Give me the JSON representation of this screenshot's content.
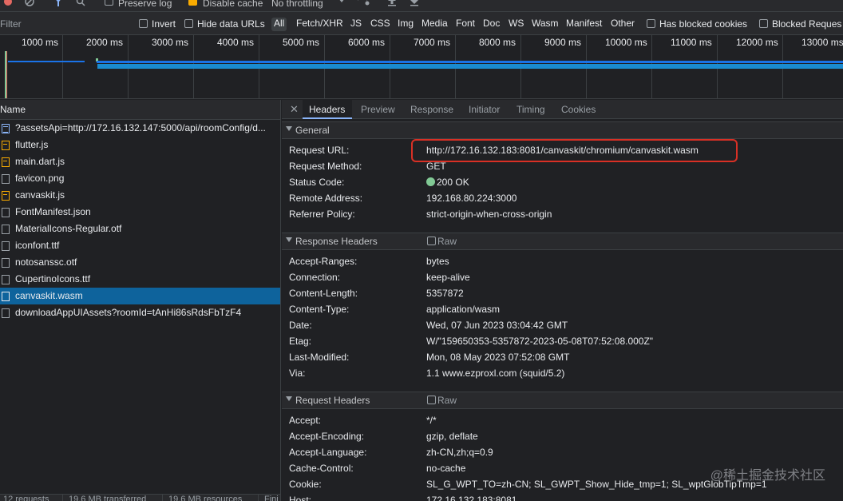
{
  "toolbar": {
    "preserve_log_label": "Preserve log",
    "disable_cache_label": "Disable cache",
    "throttling_value": "No throttling"
  },
  "filter": {
    "placeholder": "Filter",
    "invert_label": "Invert",
    "hide_data_urls_label": "Hide data URLs",
    "types": [
      "All",
      "Fetch/XHR",
      "JS",
      "CSS",
      "Img",
      "Media",
      "Font",
      "Doc",
      "WS",
      "Wasm",
      "Manifest",
      "Other"
    ],
    "has_blocked_cookies_label": "Has blocked cookies",
    "blocked_requests_label": "Blocked Reques"
  },
  "timeline": {
    "ticks": [
      "1000 ms",
      "2000 ms",
      "3000 ms",
      "4000 ms",
      "5000 ms",
      "6000 ms",
      "7000 ms",
      "8000 ms",
      "9000 ms",
      "10000 ms",
      "11000 ms",
      "12000 ms",
      "13000 ms"
    ]
  },
  "requests": {
    "header": "Name",
    "items": [
      {
        "name": "?assetsApi=http://172.16.132.147:5000/api/roomConfig/d...",
        "type": "doc"
      },
      {
        "name": "flutter.js",
        "type": "js"
      },
      {
        "name": "main.dart.js",
        "type": "js"
      },
      {
        "name": "favicon.png",
        "type": "file"
      },
      {
        "name": "canvaskit.js",
        "type": "js"
      },
      {
        "name": "FontManifest.json",
        "type": "file"
      },
      {
        "name": "MaterialIcons-Regular.otf",
        "type": "file"
      },
      {
        "name": "iconfont.ttf",
        "type": "file"
      },
      {
        "name": "notosanssc.otf",
        "type": "file"
      },
      {
        "name": "CupertinoIcons.ttf",
        "type": "file"
      },
      {
        "name": "canvaskit.wasm",
        "type": "file",
        "selected": true
      },
      {
        "name": "downloadAppUIAssets?roomId=tAnHi86sRdsFbTzF4",
        "type": "file"
      }
    ]
  },
  "status": {
    "requests": "12 requests",
    "transferred": "19.6 MB transferred",
    "resources": "19.6 MB resources",
    "finish": "Fini"
  },
  "details": {
    "tabs": [
      "Headers",
      "Preview",
      "Response",
      "Initiator",
      "Timing",
      "Cookies"
    ],
    "general": {
      "title": "General",
      "rows": [
        {
          "k": "Request URL:",
          "v": "http://172.16.132.183:8081/canvaskit/chromium/canvaskit.wasm"
        },
        {
          "k": "Request Method:",
          "v": "GET"
        },
        {
          "k": "Status Code:",
          "v": "200 OK"
        },
        {
          "k": "Remote Address:",
          "v": "192.168.80.224:3000"
        },
        {
          "k": "Referrer Policy:",
          "v": "strict-origin-when-cross-origin"
        }
      ]
    },
    "response_headers": {
      "title": "Response Headers",
      "raw_label": "Raw",
      "rows": [
        {
          "k": "Accept-Ranges:",
          "v": "bytes"
        },
        {
          "k": "Connection:",
          "v": "keep-alive"
        },
        {
          "k": "Content-Length:",
          "v": "5357872"
        },
        {
          "k": "Content-Type:",
          "v": "application/wasm"
        },
        {
          "k": "Date:",
          "v": "Wed, 07 Jun 2023 03:04:42 GMT"
        },
        {
          "k": "Etag:",
          "v": "W/\"159650353-5357872-2023-05-08T07:52:08.000Z\""
        },
        {
          "k": "Last-Modified:",
          "v": "Mon, 08 May 2023 07:52:08 GMT"
        },
        {
          "k": "Via:",
          "v": "1.1 www.ezproxl.com (squid/5.2)"
        }
      ]
    },
    "request_headers": {
      "title": "Request Headers",
      "raw_label": "Raw",
      "rows": [
        {
          "k": "Accept:",
          "v": "*/*"
        },
        {
          "k": "Accept-Encoding:",
          "v": "gzip, deflate"
        },
        {
          "k": "Accept-Language:",
          "v": "zh-CN,zh;q=0.9"
        },
        {
          "k": "Cache-Control:",
          "v": "no-cache"
        },
        {
          "k": "Cookie:",
          "v": "SL_G_WPT_TO=zh-CN; SL_GWPT_Show_Hide_tmp=1; SL_wptGlobTipTmp=1"
        },
        {
          "k": "Host:",
          "v": "172.16.132.183:8081"
        }
      ]
    }
  },
  "watermark": "@稀土掘金技术社区",
  "colors": {
    "accent_blue": "#8ab4f8",
    "selected_row": "#0e639c",
    "status_ok": "#81c995",
    "highlight_red": "#d93025",
    "checkbox_orange": "#f9ab00"
  }
}
